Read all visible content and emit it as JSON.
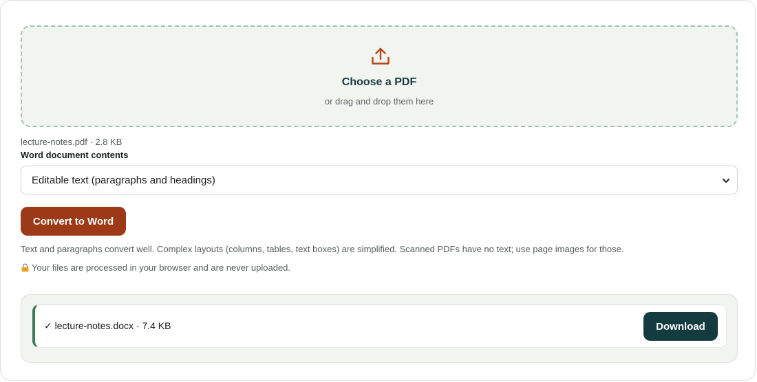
{
  "dropzone": {
    "icon": "upload-icon",
    "title": "Choose a PDF",
    "subtitle": "or drag and drop them here"
  },
  "selected_file": {
    "meta": "lecture-notes.pdf · 2.8 KB"
  },
  "contents_select": {
    "label": "Word document contents",
    "value": "Editable text (paragraphs and headings)",
    "icon": "chevron-down-icon"
  },
  "actions": {
    "convert_label": "Convert to Word"
  },
  "info": {
    "note": "Text and paragraphs convert well. Complex layouts (columns, tables, text boxes) are simplified. Scanned PDFs have no text; use page images for those.",
    "privacy_icon": "lock-icon",
    "privacy": "Your files are processed in your browser and are never uploaded."
  },
  "results": {
    "items": [
      {
        "status_icon": "checkmark",
        "text": "✓ lecture-notes.docx · 7.4 KB",
        "download_label": "Download"
      }
    ]
  },
  "colors": {
    "accent": "#9c3a17",
    "primary_dark": "#143b40",
    "success": "#3c7a5a",
    "dropzone_border": "#9ec5b3",
    "panel_bg": "#f2f4f0"
  }
}
